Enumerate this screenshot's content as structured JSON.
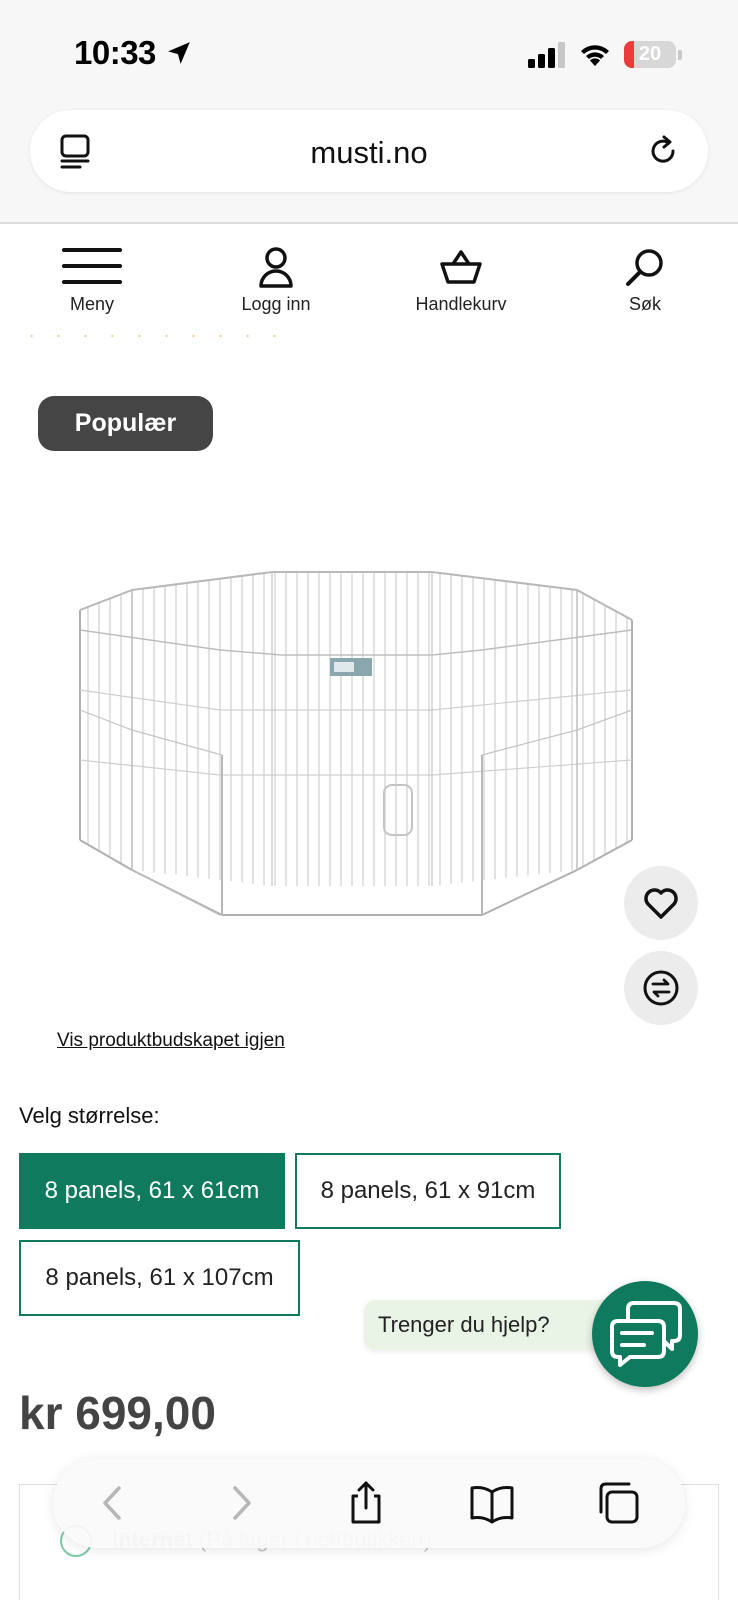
{
  "status_bar": {
    "time": "10:33",
    "battery": "20",
    "battery_level_percent": 20,
    "icons": [
      "location-arrow-icon",
      "cellular-signal-icon",
      "wifi-icon",
      "battery-icon"
    ]
  },
  "browser": {
    "url": "musti.no",
    "icons": [
      "reader-mode-icon",
      "reload-icon"
    ]
  },
  "site_nav": {
    "items": [
      {
        "label": "Meny",
        "icon": "hamburger-menu-icon"
      },
      {
        "label": "Logg inn",
        "icon": "user-icon"
      },
      {
        "label": "Handlekurv",
        "icon": "basket-icon"
      },
      {
        "label": "Søk",
        "icon": "search-icon"
      }
    ]
  },
  "product": {
    "badge": "Populær",
    "image_icon": "playpen-product-image",
    "actions": [
      "heart-icon",
      "compare-icon"
    ],
    "show_message_link": "Vis produktbudskapet igjen",
    "size_label": "Velg størrelse:",
    "sizes": [
      {
        "label": "8 panels, 61 x 61cm",
        "selected": true
      },
      {
        "label": "8 panels, 61 x 91cm",
        "selected": false
      },
      {
        "label": "8 panels, 61 x 107cm",
        "selected": false
      }
    ],
    "price": "kr 699,00",
    "stock_status": "Internet",
    "stock_detail": "(På lager i nettbutikken)"
  },
  "help": {
    "text": "Trenger du hjelp?",
    "icon": "chat-icon"
  },
  "toolbar": {
    "items": [
      "back-icon",
      "forward-icon",
      "share-icon",
      "bookmarks-icon",
      "tabs-icon"
    ]
  },
  "colors": {
    "brand_green": "#0f7a5d",
    "badge_gray": "#454545",
    "help_bg": "#e9f4e6",
    "battery_red": "#eb3b3b"
  }
}
